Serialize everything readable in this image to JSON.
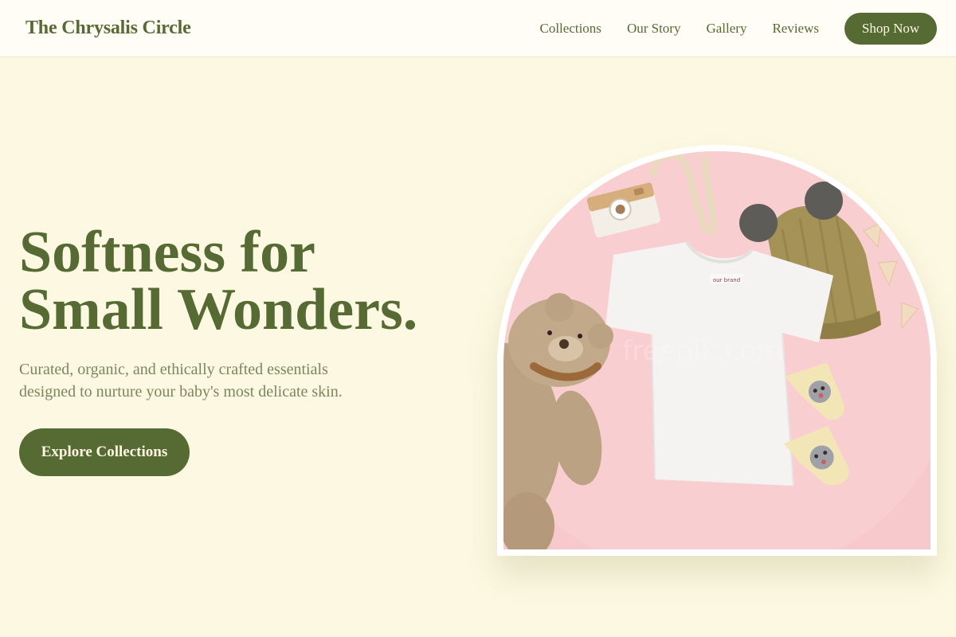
{
  "header": {
    "brand": "The Chrysalis Circle",
    "nav": [
      {
        "label": "Collections"
      },
      {
        "label": "Our Story"
      },
      {
        "label": "Gallery"
      },
      {
        "label": "Reviews"
      }
    ],
    "cta_label": "Shop Now"
  },
  "hero": {
    "title_line1": "Softness for",
    "title_line2": "Small Wonders.",
    "subtitle": "Curated, organic, and ethically crafted essentials designed to nurture your baby's most delicate skin.",
    "button_label": "Explore Collections",
    "image": {
      "shirt_tag": "our brand",
      "watermark": "freepik.com"
    }
  },
  "colors": {
    "page_background": "#fdf8e1",
    "header_background": "#fffdf6",
    "brand_green": "#566a34",
    "subtitle_text": "#7a8760",
    "photo_background": "#f8c9cc"
  },
  "icons": [
    "toy-camera",
    "teddy-bear",
    "knit-beanie",
    "baby-socks",
    "bunting-flags"
  ]
}
